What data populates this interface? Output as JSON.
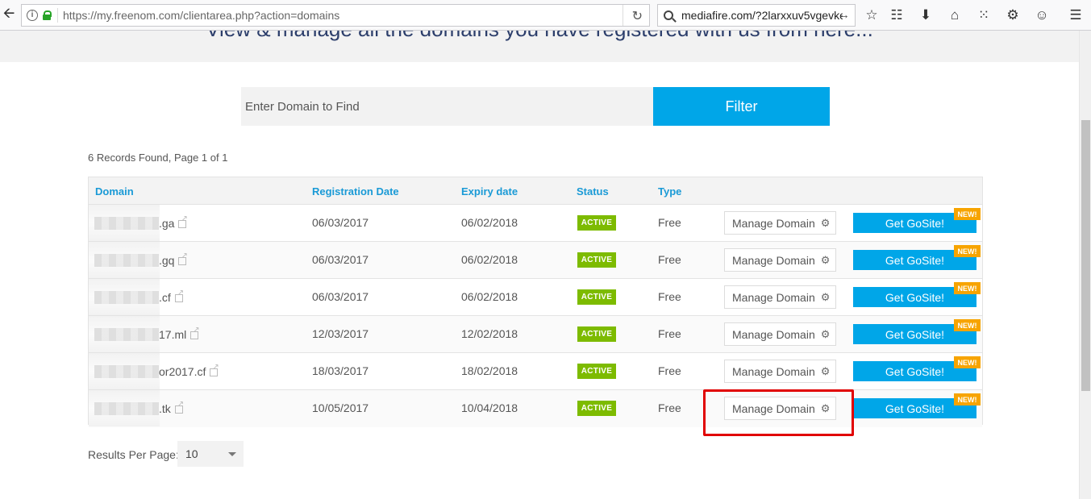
{
  "browser": {
    "url": "https://my.freenom.com/clientarea.php?action=domains",
    "search_text": "mediafire.com/?2larxxuv5vgevke"
  },
  "page": {
    "hero_text": "View & manage all the domains you have registered with us from here...",
    "filter_placeholder": "Enter Domain to Find",
    "filter_button": "Filter",
    "records_info": "6 Records Found, Page 1 of 1",
    "results_per_page_label": "Results Per Page:",
    "results_per_page_value": "10"
  },
  "table": {
    "headers": {
      "domain": "Domain",
      "registration_date": "Registration Date",
      "expiry_date": "Expiry date",
      "status": "Status",
      "type": "Type"
    },
    "rows": [
      {
        "domain": ".ga",
        "registration_date": "06/03/2017",
        "expiry_date": "06/02/2018",
        "status": "ACTIVE",
        "type": "Free",
        "manage": "Manage Domain",
        "gosite": "Get GoSite!",
        "new": "NEW!"
      },
      {
        "domain": ".gq",
        "registration_date": "06/03/2017",
        "expiry_date": "06/02/2018",
        "status": "ACTIVE",
        "type": "Free",
        "manage": "Manage Domain",
        "gosite": "Get GoSite!",
        "new": "NEW!"
      },
      {
        "domain": ".cf",
        "registration_date": "06/03/2017",
        "expiry_date": "06/02/2018",
        "status": "ACTIVE",
        "type": "Free",
        "manage": "Manage Domain",
        "gosite": "Get GoSite!",
        "new": "NEW!"
      },
      {
        "domain": "17.ml",
        "registration_date": "12/03/2017",
        "expiry_date": "12/02/2018",
        "status": "ACTIVE",
        "type": "Free",
        "manage": "Manage Domain",
        "gosite": "Get GoSite!",
        "new": "NEW!"
      },
      {
        "domain": "or2017.cf",
        "registration_date": "18/03/2017",
        "expiry_date": "18/02/2018",
        "status": "ACTIVE",
        "type": "Free",
        "manage": "Manage Domain",
        "gosite": "Get GoSite!",
        "new": "NEW!"
      },
      {
        "domain": ".tk",
        "registration_date": "10/05/2017",
        "expiry_date": "10/04/2018",
        "status": "ACTIVE",
        "type": "Free",
        "manage": "Manage Domain",
        "gosite": "Get GoSite!",
        "new": "NEW!"
      }
    ]
  },
  "colors": {
    "accent": "#00a6e8",
    "header_link": "#1a9ad6",
    "active_badge": "#7dbb00",
    "new_badge": "#f7a400",
    "highlight": "#e10000"
  },
  "icons": [
    "back-arrow-icon",
    "info-icon",
    "lock-icon",
    "reload-icon",
    "search-icon",
    "go-arrow-icon",
    "bookmark-star-icon",
    "reading-list-icon",
    "download-icon",
    "home-icon",
    "extension-icon",
    "settings-icon",
    "addon-icon",
    "menu-icon",
    "external-link-icon",
    "gear-icon"
  ]
}
